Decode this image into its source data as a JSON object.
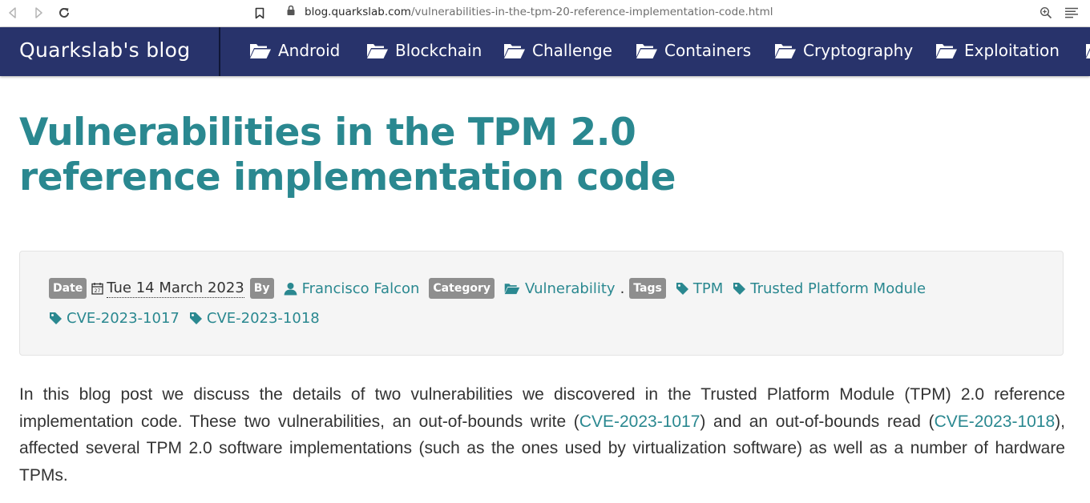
{
  "browser": {
    "url_host": "blog.quarkslab.com",
    "url_path": "/vulnerabilities-in-the-tpm-20-reference-implementation-code.html"
  },
  "site": {
    "brand": "Quarkslab's blog",
    "nav_items": [
      {
        "label": "Android"
      },
      {
        "label": "Blockchain"
      },
      {
        "label": "Challenge"
      },
      {
        "label": "Containers"
      },
      {
        "label": "Cryptography"
      },
      {
        "label": "Exploitation"
      }
    ]
  },
  "post": {
    "title": "Vulnerabilities in the TPM 2.0 reference implementation code",
    "meta": {
      "date_label": "Date",
      "date": "Tue 14 March 2023",
      "by_label": "By",
      "author": "Francisco Falcon",
      "category_label": "Category",
      "category": "Vulnerability",
      "separator": ".",
      "tags_label": "Tags",
      "tags": [
        "TPM",
        "Trusted Platform Module",
        "CVE-2023-1017",
        "CVE-2023-1018"
      ]
    },
    "body": {
      "part1": "In this blog post we discuss the details of two vulnerabilities we discovered in the Trusted Platform Module (TPM) 2.0 reference implementation code. These two vulnerabilities, an out-of-bounds write (",
      "link1": "CVE-2023-1017",
      "part2": ") and an out-of-bounds read (",
      "link2": "CVE-2023-1018",
      "part3": "), affected several TPM 2.0 software implementations (such as the ones used by virtualization software) as well as a number of hardware TPMs."
    }
  },
  "colors": {
    "navbar": "#28336b",
    "accent": "#2a8890",
    "label_bg": "#8e8e8e"
  }
}
